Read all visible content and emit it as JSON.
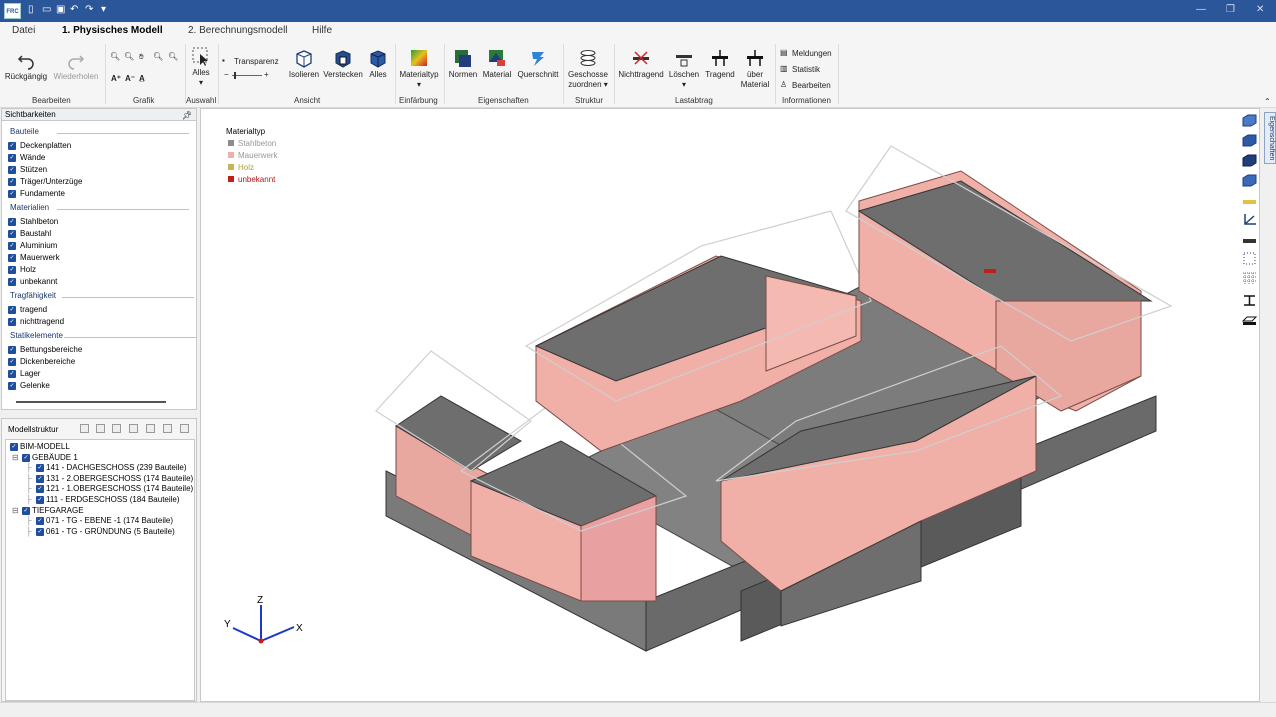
{
  "app": {
    "logo": "FRC"
  },
  "menu": {
    "tabs": [
      "Datei",
      "1. Physisches Modell",
      "2. Berechnungsmodell",
      "Hilfe"
    ]
  },
  "ribbon": {
    "bearbeiten": {
      "undo": "Rückgängig",
      "redo": "Wiederholen",
      "group": "Bearbeiten"
    },
    "grafik": {
      "group": "Grafik"
    },
    "auswahl": {
      "alles": "Alles",
      "group": "Auswahl"
    },
    "ansicht": {
      "transparenz": "Transparenz",
      "isolieren": "Isolieren",
      "verstecken": "Verstecken",
      "alles": "Alles",
      "group": "Ansicht"
    },
    "einfaerbung": {
      "materialtyp": "Materialtyp",
      "group": "Einfärbung"
    },
    "eigenschaften": {
      "normen": "Normen",
      "material": "Material",
      "querschnitt": "Querschnitt",
      "group": "Eigenschaften"
    },
    "struktur": {
      "geschosse_1": "Geschosse",
      "geschosse_2": "zuordnen",
      "group": "Struktur"
    },
    "lastabtrag": {
      "nichttragend": "Nichttragend",
      "loeschen": "Löschen",
      "tragend": "Tragend",
      "ueber_1": "über",
      "ueber_2": "Material",
      "group": "Lastabtrag"
    },
    "informationen": {
      "meldungen": "Meldungen",
      "statistik": "Statistik",
      "bearbeiten": "Bearbeiten",
      "group": "Informationen"
    }
  },
  "sicht": {
    "title": "Sichtbarkeiten",
    "groups": [
      {
        "label": "Bauteile",
        "items": [
          "Deckenplatten",
          "Wände",
          "Stützen",
          "Träger/Unterzüge",
          "Fundamente"
        ]
      },
      {
        "label": "Materialien",
        "items": [
          "Stahlbeton",
          "Baustahl",
          "Aluminium",
          "Mauerwerk",
          "Holz",
          "unbekannt"
        ]
      },
      {
        "label": "Tragfähigkeit",
        "items": [
          "tragend",
          "nichttragend"
        ]
      },
      {
        "label": "Statikelemente",
        "items": [
          "Bettungsbereiche",
          "Dickenbereiche",
          "Lager",
          "Gelenke"
        ]
      }
    ]
  },
  "modell": {
    "title": "Modellstruktur",
    "root": "BIM-MODELL",
    "gebaeude": "GEBÄUDE 1",
    "geschosse": [
      "141 - DACHGESCHOSS (239 Bauteile)",
      "131 - 2.OBERGESCHOSS (174 Bauteile)",
      "121 - 1.OBERGESCHOSS (174 Bauteile)",
      "111 - ERDGESCHOSS (184 Bauteile)"
    ],
    "tiefgarage": "TIEFGARAGE",
    "tg_items": [
      "071 - TG - EBENE -1 (174 Bauteile)",
      "061 - TG - GRÜNDUNG (5 Bauteile)"
    ]
  },
  "legend": {
    "title": "Materialtyp",
    "items": [
      {
        "label": "Stahlbeton",
        "color": "#8c8c8c"
      },
      {
        "label": "Mauerwerk",
        "color": "#f0b0a8"
      },
      {
        "label": "Holz",
        "color": "#c8b454"
      },
      {
        "label": "unbekannt",
        "color": "#c0201a"
      }
    ]
  },
  "axes": {
    "x": "X",
    "y": "Y",
    "z": "Z"
  },
  "side_tab": "Eigenschaften",
  "colors": {
    "accent": "#2b579a",
    "masonry": "#f0b0a8",
    "concrete": "#8c8c8c",
    "roof": "#6e6e6e"
  }
}
